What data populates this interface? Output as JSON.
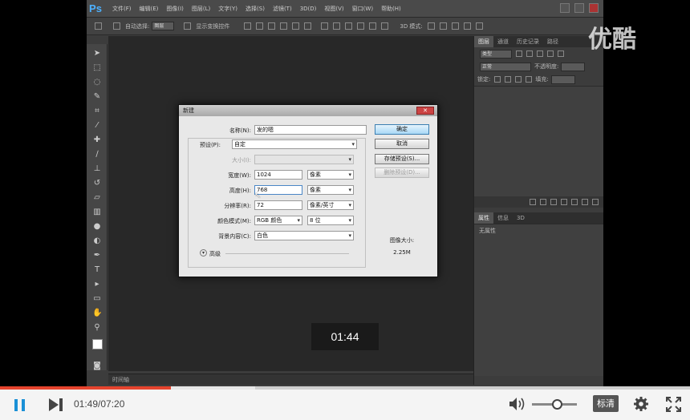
{
  "photoshop": {
    "logo": "Ps",
    "menus": [
      "文件(F)",
      "编辑(E)",
      "图像(I)",
      "图层(L)",
      "文字(Y)",
      "选择(S)",
      "滤镜(T)",
      "3D(D)",
      "视图(V)",
      "窗口(W)",
      "帮助(H)"
    ],
    "options_bar": {
      "auto_select": "自动选择:",
      "auto_select_value": "图层",
      "show_transform": "显示变换控件",
      "mode_3d": "3D 模式:"
    },
    "status_bar": "时间轴",
    "layers_panel": {
      "tabs": [
        "图层",
        "通道",
        "历史记录",
        "路径"
      ],
      "filter": "类型",
      "blend_mode": "正常",
      "opacity_label": "不透明度:",
      "lock_label": "锁定:",
      "fill_label": "填充:"
    },
    "properties_panel": {
      "tabs": [
        "属性",
        "信息",
        "3D"
      ],
      "empty_text": "无属性"
    }
  },
  "dialog": {
    "title": "新建",
    "name_label": "名称(N):",
    "name_value": "发的嗯",
    "preset_label": "预设(P):",
    "preset_value": "自定",
    "size_label": "大小(I):",
    "width_label": "宽度(W):",
    "width_value": "1024",
    "width_unit": "像素",
    "height_label": "高度(H):",
    "height_value": "768",
    "height_unit": "像素",
    "resolution_label": "分辨率(R):",
    "resolution_value": "72",
    "resolution_unit": "像素/英寸",
    "color_mode_label": "颜色模式(M):",
    "color_mode_value": "RGB 颜色",
    "bit_depth": "8 位",
    "background_label": "背景内容(C):",
    "background_value": "白色",
    "advanced_label": "高级",
    "image_size_label": "图像大小:",
    "image_size_value": "2.25M",
    "buttons": {
      "ok": "确定",
      "cancel": "取消",
      "save_preset": "存储预设(S)...",
      "delete_preset": "删除预设(D)..."
    }
  },
  "overlay_time": "01:44",
  "watermark": "优酷",
  "player": {
    "current_time": "01:49",
    "total_time": "07:20",
    "played_fraction": 0.248,
    "buffered_fraction": 0.37,
    "volume_fraction": 0.55,
    "quality": "标清"
  }
}
